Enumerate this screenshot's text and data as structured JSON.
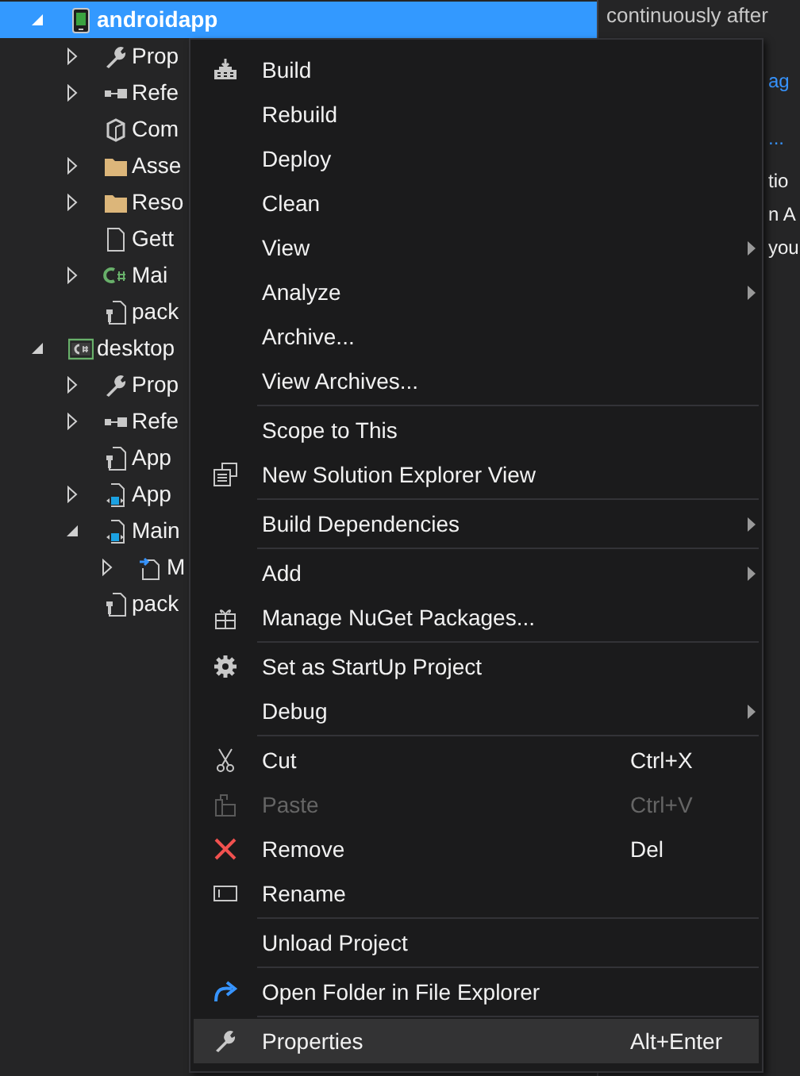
{
  "solution_explorer": {
    "items": [
      {
        "label": "androidapp",
        "expanded": true,
        "selected": true,
        "children": [
          {
            "label": "Prop",
            "expanded": false,
            "selected": false
          },
          {
            "label": "Refe",
            "expanded": false,
            "selected": false
          },
          {
            "label": "Com",
            "selected": false
          },
          {
            "label": "Asse",
            "expanded": false,
            "selected": false
          },
          {
            "label": "Reso",
            "expanded": false,
            "selected": false
          },
          {
            "label": "Gett",
            "selected": false
          },
          {
            "label": "Mai",
            "expanded": false,
            "selected": false
          },
          {
            "label": "pack",
            "selected": false
          }
        ]
      },
      {
        "label": "desktop",
        "expanded": true,
        "selected": false,
        "children": [
          {
            "label": "Prop",
            "expanded": false,
            "selected": false
          },
          {
            "label": "Refe",
            "expanded": false,
            "selected": false
          },
          {
            "label": "App",
            "selected": false
          },
          {
            "label": "App",
            "expanded": false,
            "selected": false
          },
          {
            "label": "Main",
            "expanded": true,
            "selected": false,
            "children": [
              {
                "label": "M",
                "expanded": false,
                "selected": false
              }
            ]
          },
          {
            "label": "pack",
            "selected": false
          }
        ]
      }
    ]
  },
  "side_panel": {
    "lines": [
      "continuously after"
    ],
    "fragments": [
      {
        "text": "ag",
        "kind": "link"
      },
      {
        "text": "...",
        "kind": "link"
      },
      {
        "text": "tio",
        "kind": "text"
      },
      {
        "text": "n A",
        "kind": "text"
      },
      {
        "text": "you",
        "kind": "text"
      }
    ]
  },
  "context_menu": {
    "items": [
      {
        "kind": "item",
        "label": "Build",
        "submenu": false,
        "disabled": false,
        "selected": false
      },
      {
        "kind": "item",
        "label": "Rebuild",
        "submenu": false,
        "disabled": false,
        "selected": false
      },
      {
        "kind": "item",
        "label": "Deploy",
        "submenu": false,
        "disabled": false,
        "selected": false
      },
      {
        "kind": "item",
        "label": "Clean",
        "submenu": false,
        "disabled": false,
        "selected": false
      },
      {
        "kind": "item",
        "label": "View",
        "submenu": true,
        "disabled": false,
        "selected": false
      },
      {
        "kind": "item",
        "label": "Analyze",
        "submenu": true,
        "disabled": false,
        "selected": false
      },
      {
        "kind": "item",
        "label": "Archive...",
        "submenu": false,
        "disabled": false,
        "selected": false
      },
      {
        "kind": "item",
        "label": "View Archives...",
        "submenu": false,
        "disabled": false,
        "selected": false
      },
      {
        "kind": "separator"
      },
      {
        "kind": "item",
        "label": "Scope to This",
        "submenu": false,
        "disabled": false,
        "selected": false
      },
      {
        "kind": "item",
        "label": "New Solution Explorer View",
        "submenu": false,
        "disabled": false,
        "selected": false
      },
      {
        "kind": "separator"
      },
      {
        "kind": "item",
        "label": "Build Dependencies",
        "submenu": true,
        "disabled": false,
        "selected": false
      },
      {
        "kind": "separator"
      },
      {
        "kind": "item",
        "label": "Add",
        "submenu": true,
        "disabled": false,
        "selected": false
      },
      {
        "kind": "item",
        "label": "Manage NuGet Packages...",
        "submenu": false,
        "disabled": false,
        "selected": false
      },
      {
        "kind": "separator"
      },
      {
        "kind": "item",
        "label": "Set as StartUp Project",
        "submenu": false,
        "disabled": false,
        "selected": false
      },
      {
        "kind": "item",
        "label": "Debug",
        "submenu": true,
        "disabled": false,
        "selected": false
      },
      {
        "kind": "separator"
      },
      {
        "kind": "item",
        "label": "Cut",
        "shortcut": "Ctrl+X",
        "submenu": false,
        "disabled": false,
        "selected": false
      },
      {
        "kind": "item",
        "label": "Paste",
        "shortcut": "Ctrl+V",
        "submenu": false,
        "disabled": true,
        "selected": false
      },
      {
        "kind": "item",
        "label": "Remove",
        "shortcut": "Del",
        "submenu": false,
        "disabled": false,
        "selected": false
      },
      {
        "kind": "item",
        "label": "Rename",
        "submenu": false,
        "disabled": false,
        "selected": false
      },
      {
        "kind": "separator"
      },
      {
        "kind": "item",
        "label": "Unload Project",
        "submenu": false,
        "disabled": false,
        "selected": false
      },
      {
        "kind": "separator"
      },
      {
        "kind": "item",
        "label": "Open Folder in File Explorer",
        "submenu": false,
        "disabled": false,
        "selected": false
      },
      {
        "kind": "separator"
      },
      {
        "kind": "item",
        "label": "Properties",
        "shortcut": "Alt+Enter",
        "submenu": false,
        "disabled": false,
        "selected": true
      }
    ]
  }
}
